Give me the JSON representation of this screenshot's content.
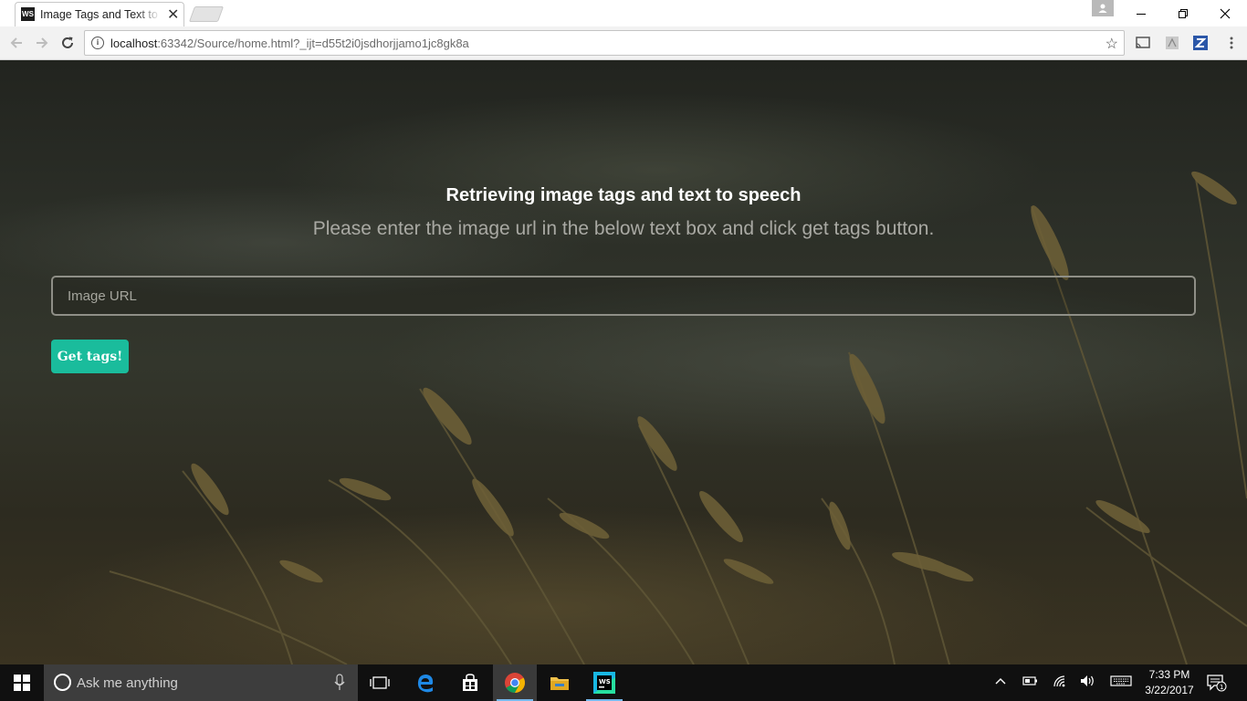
{
  "browser": {
    "tab_title": "Image Tags and Text to Speech",
    "tab_favicon": "WS",
    "url_host": "localhost",
    "url_rest": ":63342/Source/home.html?_ijt=d55t2i0jsdhorjjamo1jc8gk8a"
  },
  "page": {
    "heading": "Retrieving image tags and text to speech",
    "subheading": "Please enter the image url in the below text box and click get tags button.",
    "input_placeholder": "Image URL",
    "input_value": "",
    "button_label": "Get tags!",
    "accent_color": "#1abc9c"
  },
  "taskbar": {
    "search_placeholder": "Ask me anything",
    "time": "7:33 PM",
    "date": "3/22/2017",
    "notification_count": "1",
    "apps": [
      "task-view-icon",
      "edge-icon",
      "store-icon",
      "chrome-icon",
      "file-explorer-icon",
      "webstorm-icon"
    ]
  }
}
